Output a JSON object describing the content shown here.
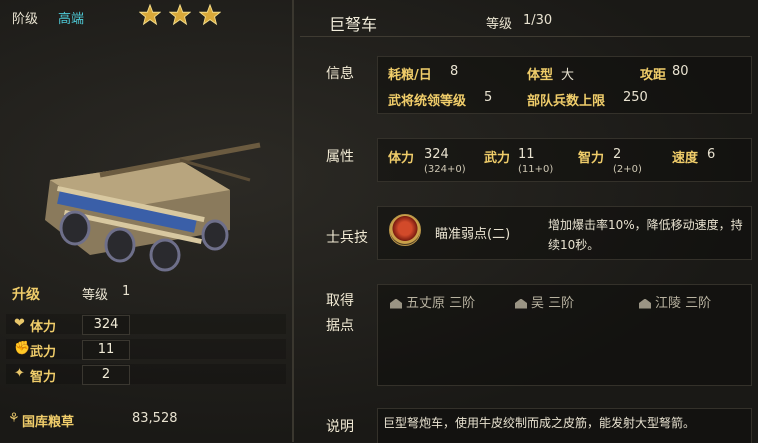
{
  "left": {
    "tier_label": "阶级",
    "tier_value": "高端",
    "stars": 3,
    "upgrade_label": "升级",
    "level_label": "等级",
    "level_value": "1",
    "stats": [
      {
        "label": "体力",
        "value": "324"
      },
      {
        "label": "武力",
        "value": "11"
      },
      {
        "label": "智力",
        "value": "2"
      }
    ],
    "storage_label": "国库粮草",
    "storage_value": "83,528"
  },
  "right": {
    "title": "巨弩车",
    "level_label": "等级",
    "level_value": "1/30",
    "info_label": "信息",
    "info": {
      "food_label": "耗粮/日",
      "food_value": "8",
      "size_label": "体型",
      "size_value": "大",
      "range_label": "攻距",
      "range_value": "80",
      "command_label": "武将统领等级",
      "command_value": "5",
      "troops_label": "部队兵数上限",
      "troops_value": "250"
    },
    "attr_label": "属性",
    "attrs": [
      {
        "label": "体力",
        "value": "324",
        "sub": "(324+0)"
      },
      {
        "label": "武力",
        "value": "11",
        "sub": "(11+0)"
      },
      {
        "label": "智力",
        "value": "2",
        "sub": "(2+0)"
      },
      {
        "label": "速度",
        "value": "6",
        "sub": ""
      }
    ],
    "skill_label": "士兵技",
    "skill_name": "瞄准弱点(二)",
    "skill_desc_line1": "增加爆击率10%，降低移动速度，持",
    "skill_desc_line2": "续10秒。",
    "acquire_label_1": "取得",
    "acquire_label_2": "据点",
    "acquire": [
      {
        "place": "五丈原",
        "tier": "三阶"
      },
      {
        "place": "吴",
        "tier": "三阶"
      },
      {
        "place": "江陵",
        "tier": "三阶"
      }
    ],
    "desc_label": "说明",
    "desc_text": "巨型弩炮车，使用牛皮绞制而成之皮筋，能发射大型弩箭。"
  }
}
